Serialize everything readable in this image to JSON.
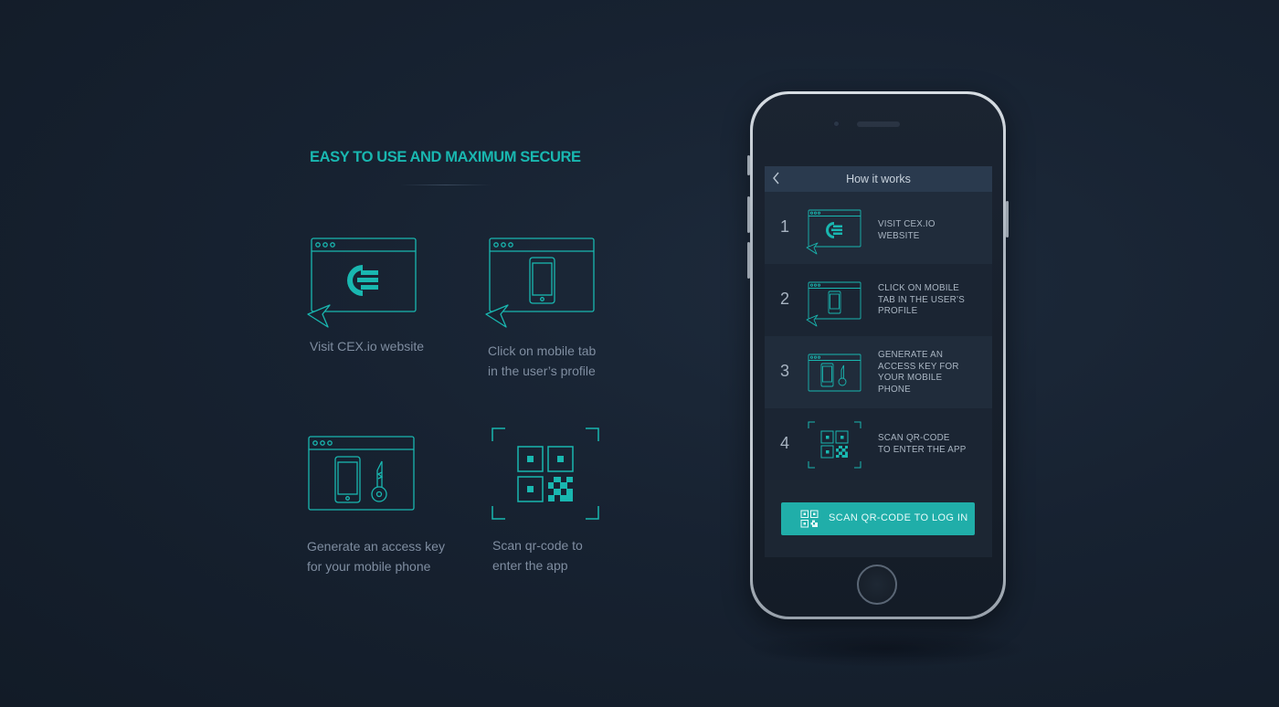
{
  "heading": "EASY TO USE AND MAXIMUM SECURE",
  "features": [
    {
      "caption_line1": "Visit CEX.io website",
      "caption_line2": "",
      "icon": "browser-cex-logo-icon"
    },
    {
      "caption_line1": "Click on mobile tab",
      "caption_line2": "in the user’s profile",
      "icon": "browser-phone-icon"
    },
    {
      "caption_line1": "Generate an access key",
      "caption_line2": "for your mobile  phone",
      "icon": "browser-phone-key-icon"
    },
    {
      "caption_line1": "Scan qr-code to",
      "caption_line2": "enter the app",
      "icon": "qr-scan-icon"
    }
  ],
  "phone": {
    "nav_title": "How it works",
    "back_icon": "chevron-left-icon",
    "steps": [
      {
        "number": "1",
        "line1": "VISIT CEX.IO",
        "line2": "WEBSITE",
        "line3": "",
        "line4": ""
      },
      {
        "number": "2",
        "line1": "CLICK ON MOBILE",
        "line2": "TAB IN THE USER’S",
        "line3": "PROFILE",
        "line4": ""
      },
      {
        "number": "3",
        "line1": "GENERATE AN",
        "line2": "ACCESS KEY FOR",
        "line3": "YOUR MOBILE",
        "line4": "PHONE"
      },
      {
        "number": "4",
        "line1": "SCAN QR-CODE",
        "line2": "TO ENTER THE APP",
        "line3": "",
        "line4": ""
      }
    ],
    "scan_button_label": "SCAN QR-CODE TO LOG IN"
  },
  "colors": {
    "accent": "#19b7b0",
    "background": "#172231",
    "button": "#20aea9"
  }
}
